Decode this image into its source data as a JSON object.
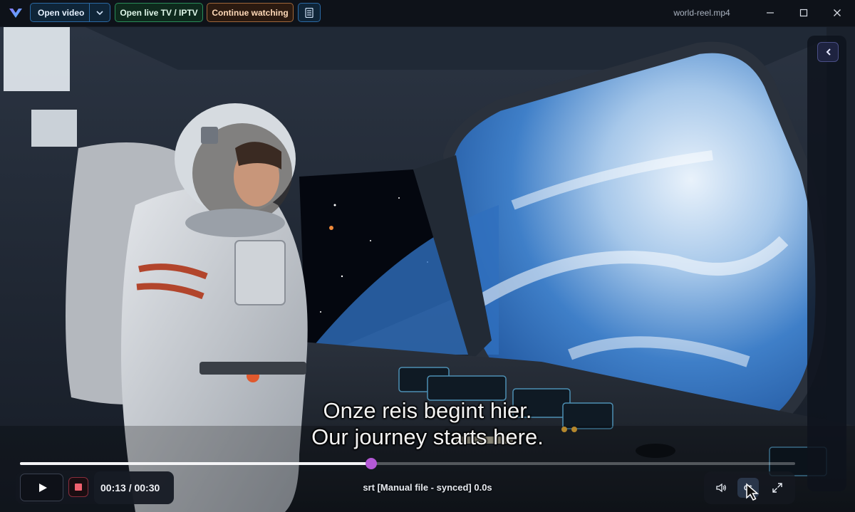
{
  "titlebar": {
    "open_video_label": "Open video",
    "live_tv_label": "Open live TV / IPTV",
    "continue_label": "Continue watching",
    "filename": "world-reel.mp4"
  },
  "player": {
    "subtitle_line_1": "Onze reis begint hier.",
    "subtitle_line_2": "Our journey starts here.",
    "time_display": "00:13 / 00:30",
    "subtitle_info": "srt [Manual file - synced] 0.0s",
    "progress_fraction": 0.453
  },
  "icons": {
    "logo": "app-logo-icon",
    "dropdown": "chevron-down-icon",
    "menu": "document-menu-icon",
    "minimize": "minimize-icon",
    "maximize": "maximize-icon",
    "close": "close-icon",
    "panel_toggle": "chevron-left-icon",
    "play": "play-icon",
    "stop": "stop-icon",
    "volume": "volume-icon",
    "subtitles": "subtitles-icon",
    "fullscreen": "fullscreen-icon"
  },
  "colors": {
    "progress_knob": "#b459d6",
    "open_video_accent": "#2b6aa5",
    "live_tv_accent": "#2a8d59",
    "continue_accent": "#a0673a",
    "stop_accent": "#f0616f"
  }
}
